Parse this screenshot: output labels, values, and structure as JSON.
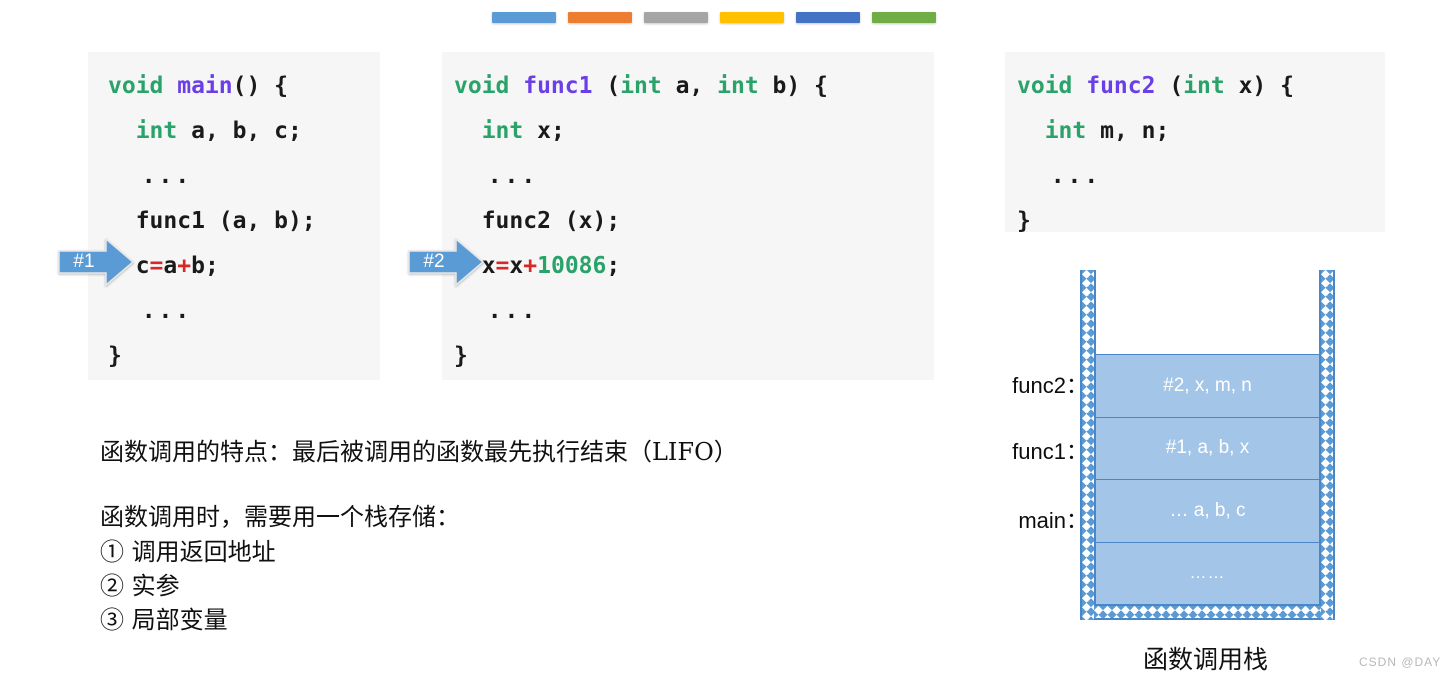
{
  "color_strip": {
    "name": "decorative-color-bars",
    "swatches": [
      {
        "name": "blue",
        "hex": "#5B9BD5"
      },
      {
        "name": "orange",
        "hex": "#ED7D31"
      },
      {
        "name": "grey",
        "hex": "#A5A5A5"
      },
      {
        "name": "yellow",
        "hex": "#FFC000"
      },
      {
        "name": "dark-blue",
        "hex": "#4472C4"
      },
      {
        "name": "green",
        "hex": "#70AD47"
      }
    ]
  },
  "code_blocks": {
    "main": {
      "title": "main",
      "line1_kw": "void",
      "line1_fn": " main",
      "line1_rest": "() {",
      "line2_kw": "  int",
      "line2_rest": " a, b, c;",
      "line3": "  ...",
      "line4": "  func1 (a, b);",
      "line5_pre": "  c",
      "line5_op1": "=",
      "line5_mid": "a",
      "line5_op2": "+",
      "line5_post": "b;",
      "line6": "  ...",
      "line7": "}"
    },
    "func1": {
      "title": "func1",
      "line1_kw": "void",
      "line1_fn": " func1",
      "line1_mid": " (",
      "line1_kw2": "int",
      "line1_mid2": " a, ",
      "line1_kw3": "int",
      "line1_rest": " b) {",
      "line2_kw": "  int",
      "line2_rest": " x;",
      "line3": "  ...",
      "line4": "  func2 (x);",
      "line5_pre": "  x",
      "line5_op1": "=",
      "line5_mid": "x",
      "line5_op2": "+",
      "line5_num": "10086",
      "line5_post": ";",
      "line6": "  ...",
      "line7": "}"
    },
    "func2": {
      "title": "func2",
      "line1_kw": "void",
      "line1_fn": " func2",
      "line1_mid": " (",
      "line1_kw2": "int",
      "line1_rest": " x) {",
      "line2_kw": "  int",
      "line2_rest": " m, n;",
      "line3": "  ...",
      "line4": "}"
    }
  },
  "markers": {
    "step1": "#1",
    "step2": "#2",
    "fill_hex": "#5B9BD5"
  },
  "notes": {
    "lifo": "函数调用的特点：最后被调用的函数最先执行结束（LIFO）",
    "intro": "函数调用时，需要用一个栈存储：",
    "item1": "① 调用返回地址",
    "item2": "② 实参",
    "item3": "③ 局部变量"
  },
  "stack": {
    "caption": "函数调用栈",
    "frame_fill_hex": "#A3C5E7",
    "border_hex": "#4A86C8",
    "labels": {
      "func2": "func2：",
      "func1": "func1：",
      "main": "main："
    },
    "frames": [
      {
        "name": "func2-frame",
        "text": "#2, x, m, n"
      },
      {
        "name": "func1-frame",
        "text": "#1, a, b, x"
      },
      {
        "name": "main-frame",
        "text": "… a, b, c"
      },
      {
        "name": "filler-frame",
        "text": "……"
      }
    ]
  },
  "watermark": {
    "text": "CSDN @DAY |"
  }
}
